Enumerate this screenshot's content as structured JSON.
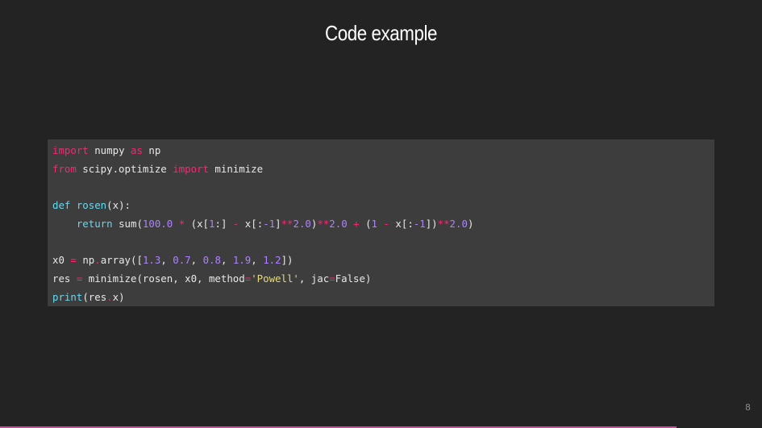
{
  "slide": {
    "title": "Code example",
    "page_number": "8",
    "progress": 0.888
  },
  "code": {
    "lines": [
      [
        {
          "t": "import",
          "c": "kw"
        },
        {
          "t": " numpy ",
          "c": ""
        },
        {
          "t": "as",
          "c": "kw"
        },
        {
          "t": " np",
          "c": ""
        }
      ],
      [
        {
          "t": "from",
          "c": "kw"
        },
        {
          "t": " scipy.optimize ",
          "c": ""
        },
        {
          "t": "import",
          "c": "kw"
        },
        {
          "t": " minimize",
          "c": ""
        }
      ],
      [],
      [
        {
          "t": "def ",
          "c": "fn"
        },
        {
          "t": "rosen",
          "c": "fn"
        },
        {
          "t": "(x):",
          "c": ""
        }
      ],
      [
        {
          "t": "    ",
          "c": ""
        },
        {
          "t": "return",
          "c": "fn"
        },
        {
          "t": " sum(",
          "c": ""
        },
        {
          "t": "100.0",
          "c": "num"
        },
        {
          "t": " ",
          "c": ""
        },
        {
          "t": "*",
          "c": "op"
        },
        {
          "t": " (x[",
          "c": ""
        },
        {
          "t": "1",
          "c": "num"
        },
        {
          "t": ":] ",
          "c": ""
        },
        {
          "t": "-",
          "c": "op"
        },
        {
          "t": " x[:",
          "c": ""
        },
        {
          "t": "-1",
          "c": "num"
        },
        {
          "t": "]",
          "c": ""
        },
        {
          "t": "**",
          "c": "op"
        },
        {
          "t": "2.0",
          "c": "num"
        },
        {
          "t": ")",
          "c": ""
        },
        {
          "t": "**",
          "c": "op"
        },
        {
          "t": "2.0",
          "c": "num"
        },
        {
          "t": " ",
          "c": ""
        },
        {
          "t": "+",
          "c": "op"
        },
        {
          "t": " (",
          "c": ""
        },
        {
          "t": "1",
          "c": "num"
        },
        {
          "t": " ",
          "c": ""
        },
        {
          "t": "-",
          "c": "op"
        },
        {
          "t": " x[:",
          "c": ""
        },
        {
          "t": "-1",
          "c": "num"
        },
        {
          "t": "])",
          "c": ""
        },
        {
          "t": "**",
          "c": "op"
        },
        {
          "t": "2.0",
          "c": "num"
        },
        {
          "t": ")",
          "c": ""
        }
      ],
      [],
      [
        {
          "t": "x0 ",
          "c": ""
        },
        {
          "t": "=",
          "c": "op"
        },
        {
          "t": " np",
          "c": ""
        },
        {
          "t": ".",
          "c": "op"
        },
        {
          "t": "array([",
          "c": ""
        },
        {
          "t": "1.3",
          "c": "num"
        },
        {
          "t": ", ",
          "c": ""
        },
        {
          "t": "0.7",
          "c": "num"
        },
        {
          "t": ", ",
          "c": ""
        },
        {
          "t": "0.8",
          "c": "num"
        },
        {
          "t": ", ",
          "c": ""
        },
        {
          "t": "1.9",
          "c": "num"
        },
        {
          "t": ", ",
          "c": ""
        },
        {
          "t": "1.2",
          "c": "num"
        },
        {
          "t": "])",
          "c": ""
        }
      ],
      [
        {
          "t": "res ",
          "c": ""
        },
        {
          "t": "=",
          "c": "op"
        },
        {
          "t": " minimize(rosen, x0, method",
          "c": ""
        },
        {
          "t": "=",
          "c": "op"
        },
        {
          "t": "'Powell'",
          "c": "str"
        },
        {
          "t": ", jac",
          "c": ""
        },
        {
          "t": "=",
          "c": "op"
        },
        {
          "t": "False)",
          "c": ""
        }
      ],
      [
        {
          "t": "print",
          "c": "fn"
        },
        {
          "t": "(res",
          "c": ""
        },
        {
          "t": ".",
          "c": "op"
        },
        {
          "t": "x)",
          "c": ""
        }
      ]
    ]
  },
  "colors": {
    "background": "#232323",
    "code_background": "#3d3d3d",
    "keyword": "#f92672",
    "function": "#66d9ef",
    "number": "#ae81ff",
    "string": "#e6db74",
    "progress": "#e040a0"
  }
}
